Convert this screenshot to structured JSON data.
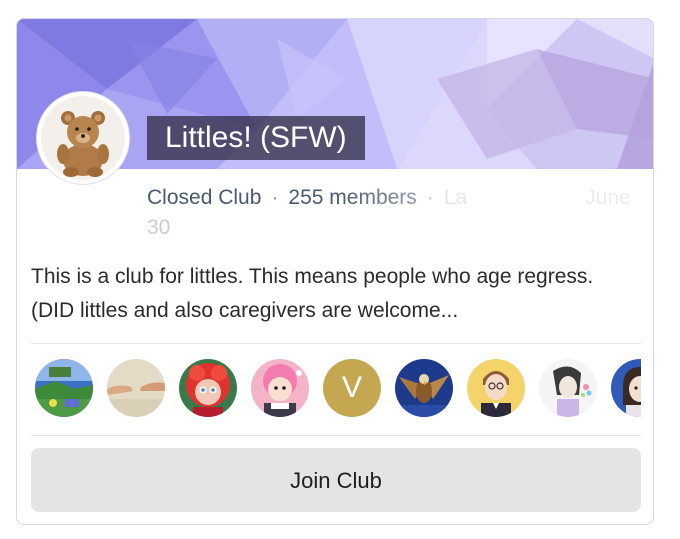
{
  "club": {
    "title": "Littles! (SFW)",
    "type": "Closed Club",
    "members_count": "255 members",
    "separator": "·",
    "last_activity_partial": "La",
    "last_activity_tail": "June",
    "last_activity_wrap": "30",
    "description": "This is a club for littles. This means people who age regress. (DID littles and also caregivers are welcome..."
  },
  "members": [
    {
      "icon": "landscape-avatar"
    },
    {
      "icon": "hands-painting-avatar"
    },
    {
      "icon": "red-haired-character-avatar"
    },
    {
      "icon": "pink-haired-character-avatar"
    },
    {
      "icon": "letter-avatar",
      "letter": "V",
      "color": "#c6a751"
    },
    {
      "icon": "eagle-avatar"
    },
    {
      "icon": "cartoon-boy-avatar"
    },
    {
      "icon": "sketch-character-avatar"
    },
    {
      "icon": "girl-portrait-avatar"
    }
  ],
  "actions": {
    "join_label": "Join Club"
  },
  "colors": {
    "banner_primary": "#8e8ae6",
    "title_background": "#343048",
    "meta_text": "#4a5a72",
    "button_background": "#e4e4e4"
  }
}
